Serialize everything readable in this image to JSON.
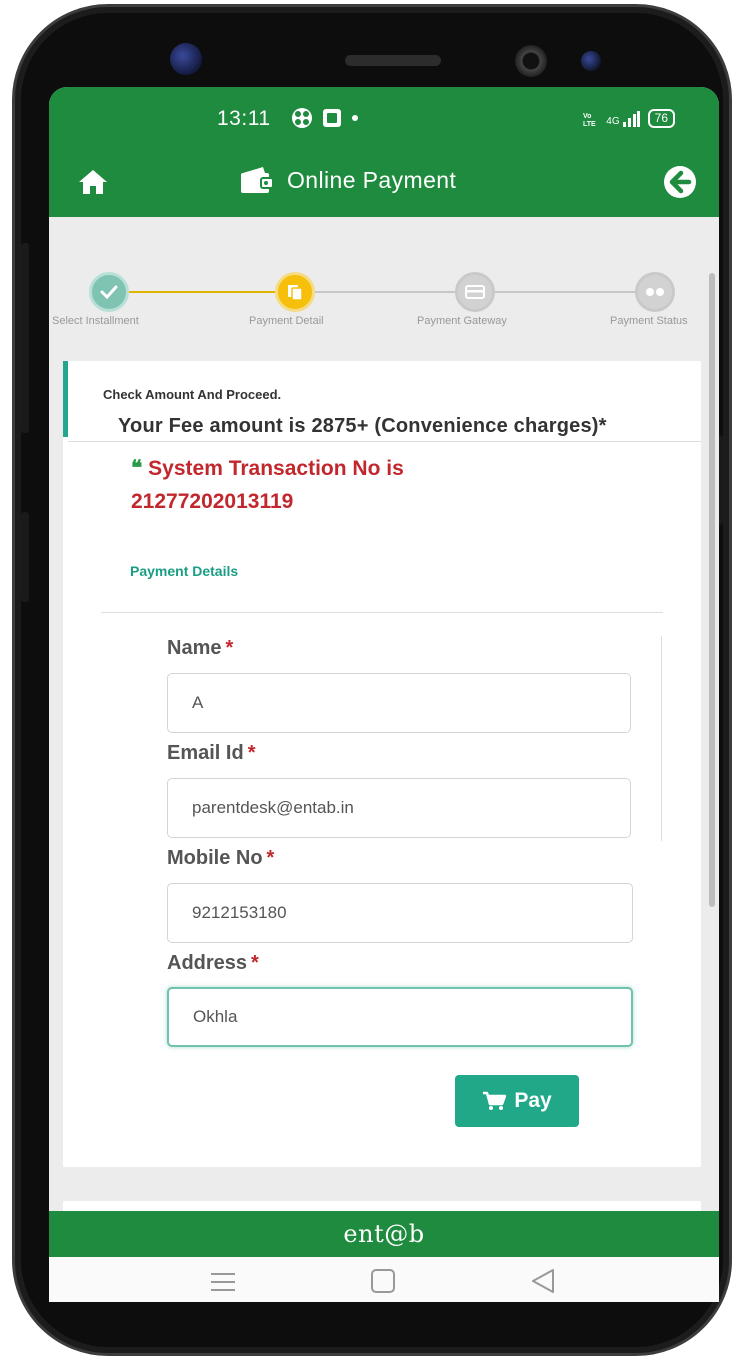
{
  "status_bar": {
    "time": "13:11",
    "icons_left": [
      "app-notification-icon",
      "gallery-icon",
      "dot-icon"
    ],
    "network": "4G",
    "battery": "76"
  },
  "header": {
    "title": "Online Payment",
    "home_icon": "home-icon",
    "title_icon": "wallet-icon",
    "back_icon": "back-arrow-circle-icon"
  },
  "stepper": {
    "steps": [
      {
        "label": "Select Installment",
        "state": "done"
      },
      {
        "label": "Payment Detail",
        "state": "active"
      },
      {
        "label": "Payment Gateway",
        "state": "pending"
      },
      {
        "label": "Payment Status",
        "state": "pending"
      }
    ]
  },
  "notice": {
    "check_text": "Check Amount And Proceed.",
    "fee_text": "Your Fee amount is 2875+ (Convenience charges)*"
  },
  "transaction": {
    "quote_glyph": "❝",
    "prefix": "System Transaction No is",
    "number": "21277202013119"
  },
  "payment_details": {
    "section_label": "Payment Details",
    "required_mark": "*",
    "fields": [
      {
        "label": "Name",
        "value": "A"
      },
      {
        "label": "Email Id",
        "value": "parentdesk@entab.in"
      },
      {
        "label": "Mobile No",
        "value": "9212153180"
      },
      {
        "label": "Address",
        "value": "Okhla"
      }
    ],
    "pay_button": "Pay"
  },
  "footer": {
    "logo_text": "ent@b"
  },
  "colors": {
    "brand_green": "#1e8b3e",
    "accent_teal": "#20a889",
    "error_red": "#c1272d",
    "step_active": "#f5bf0a"
  }
}
